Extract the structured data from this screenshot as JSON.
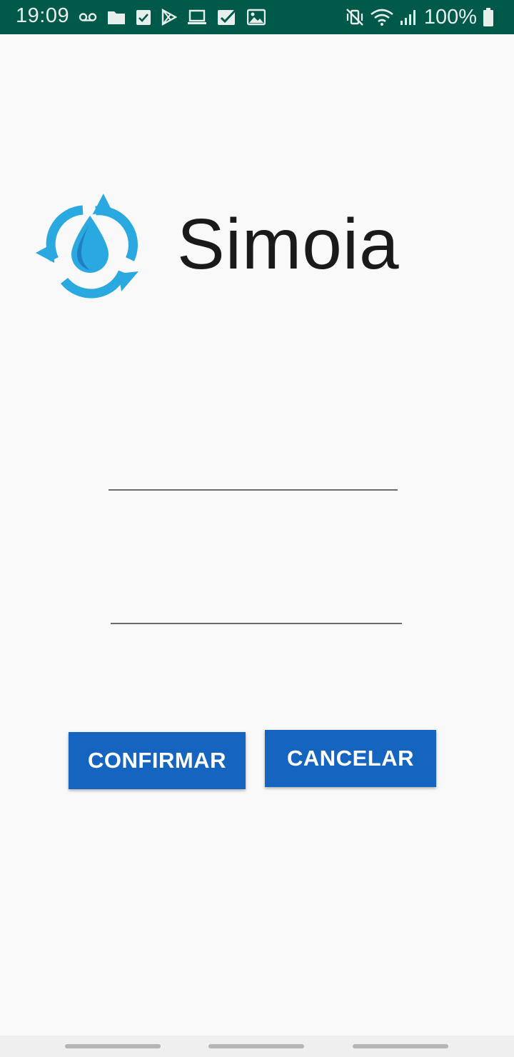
{
  "status_bar": {
    "time": "19:09",
    "battery_text": "100%",
    "background_color": "#01594a",
    "left_icons": [
      "voicemail-icon",
      "folder-icon",
      "clipboard-check-icon",
      "play-store-icon",
      "laptop-icon",
      "checkbox-icon",
      "image-icon"
    ],
    "right_icons": [
      "vibrate-mute-icon",
      "wifi-icon",
      "signal-icon",
      "battery-icon"
    ]
  },
  "app": {
    "title": "Simoia",
    "logo_color": "#29a9df",
    "logo_drop_color": "#1f7fc4"
  },
  "form": {
    "field_1_value": "",
    "field_1_placeholder": "",
    "field_2_value": "",
    "field_2_placeholder": ""
  },
  "buttons": {
    "confirm_label": "CONFIRMAR",
    "cancel_label": "CANCELAR",
    "color": "#1565c0"
  },
  "nav_bar": {
    "items": [
      "recent-apps",
      "home",
      "back"
    ]
  }
}
